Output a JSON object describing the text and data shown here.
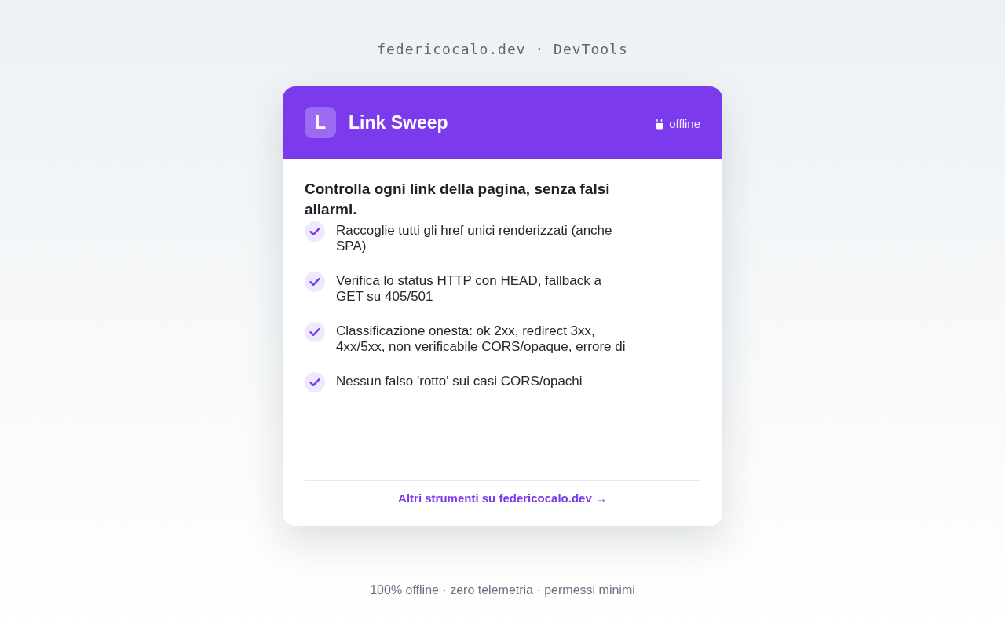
{
  "site_label": "federicocalo.dev · DevTools",
  "card": {
    "logo_letter": "L",
    "title": "Link Sweep",
    "status": {
      "label": "offline"
    },
    "headline": "Controlla ogni link della pagina, senza falsi allarmi.",
    "features": [
      {
        "text": "Raccoglie tutti gli href unici renderizzati (anche SPA)"
      },
      {
        "text": "Verifica lo status HTTP con HEAD, fallback a GET su 405/501"
      },
      {
        "text": "Classificazione onesta: ok 2xx, redirect 3xx, 4xx/5xx, non verificabile CORS/opaque, errore di"
      },
      {
        "text": "Nessun falso 'rotto' sui casi CORS/opachi"
      }
    ],
    "footer_link": "Altri strumenti su federicocalo.dev →"
  },
  "footer": "100% offline · zero telemetria · permessi minimi"
}
